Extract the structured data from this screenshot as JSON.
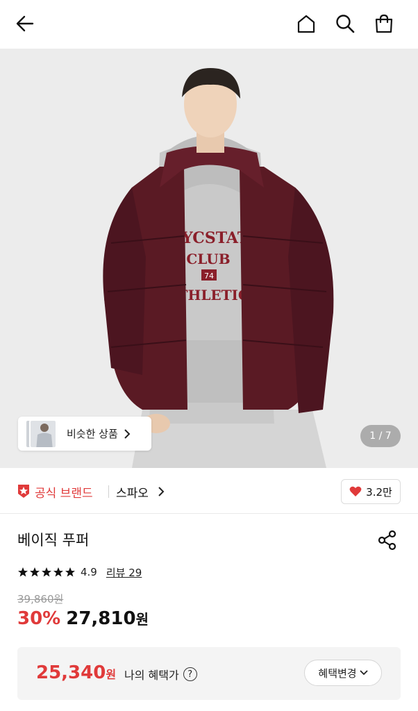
{
  "nav": {
    "back_icon": "arrow-left-icon",
    "home_icon": "home-icon",
    "search_icon": "search-icon",
    "cart_icon": "shopping-bag-icon"
  },
  "hero": {
    "similar_label": "비슷한 상품",
    "counter": "1 / 7",
    "image_alt": "product-photo-burgundy-puffer"
  },
  "brand": {
    "official_label": "공식 브랜드",
    "name": "스파오",
    "likes": "3.2만",
    "accent": "#e03a3a"
  },
  "product": {
    "title": "베이직 푸퍼",
    "rating": "4.9",
    "review_label": "리뷰 29",
    "stars": 5,
    "original_price": "39,860원",
    "discount": "30%",
    "price": "27,810",
    "price_unit": "원"
  },
  "benefit": {
    "amount": "25,340",
    "unit": "원",
    "label": "나의 혜택가",
    "help": "?",
    "button_label": "혜택변경"
  }
}
